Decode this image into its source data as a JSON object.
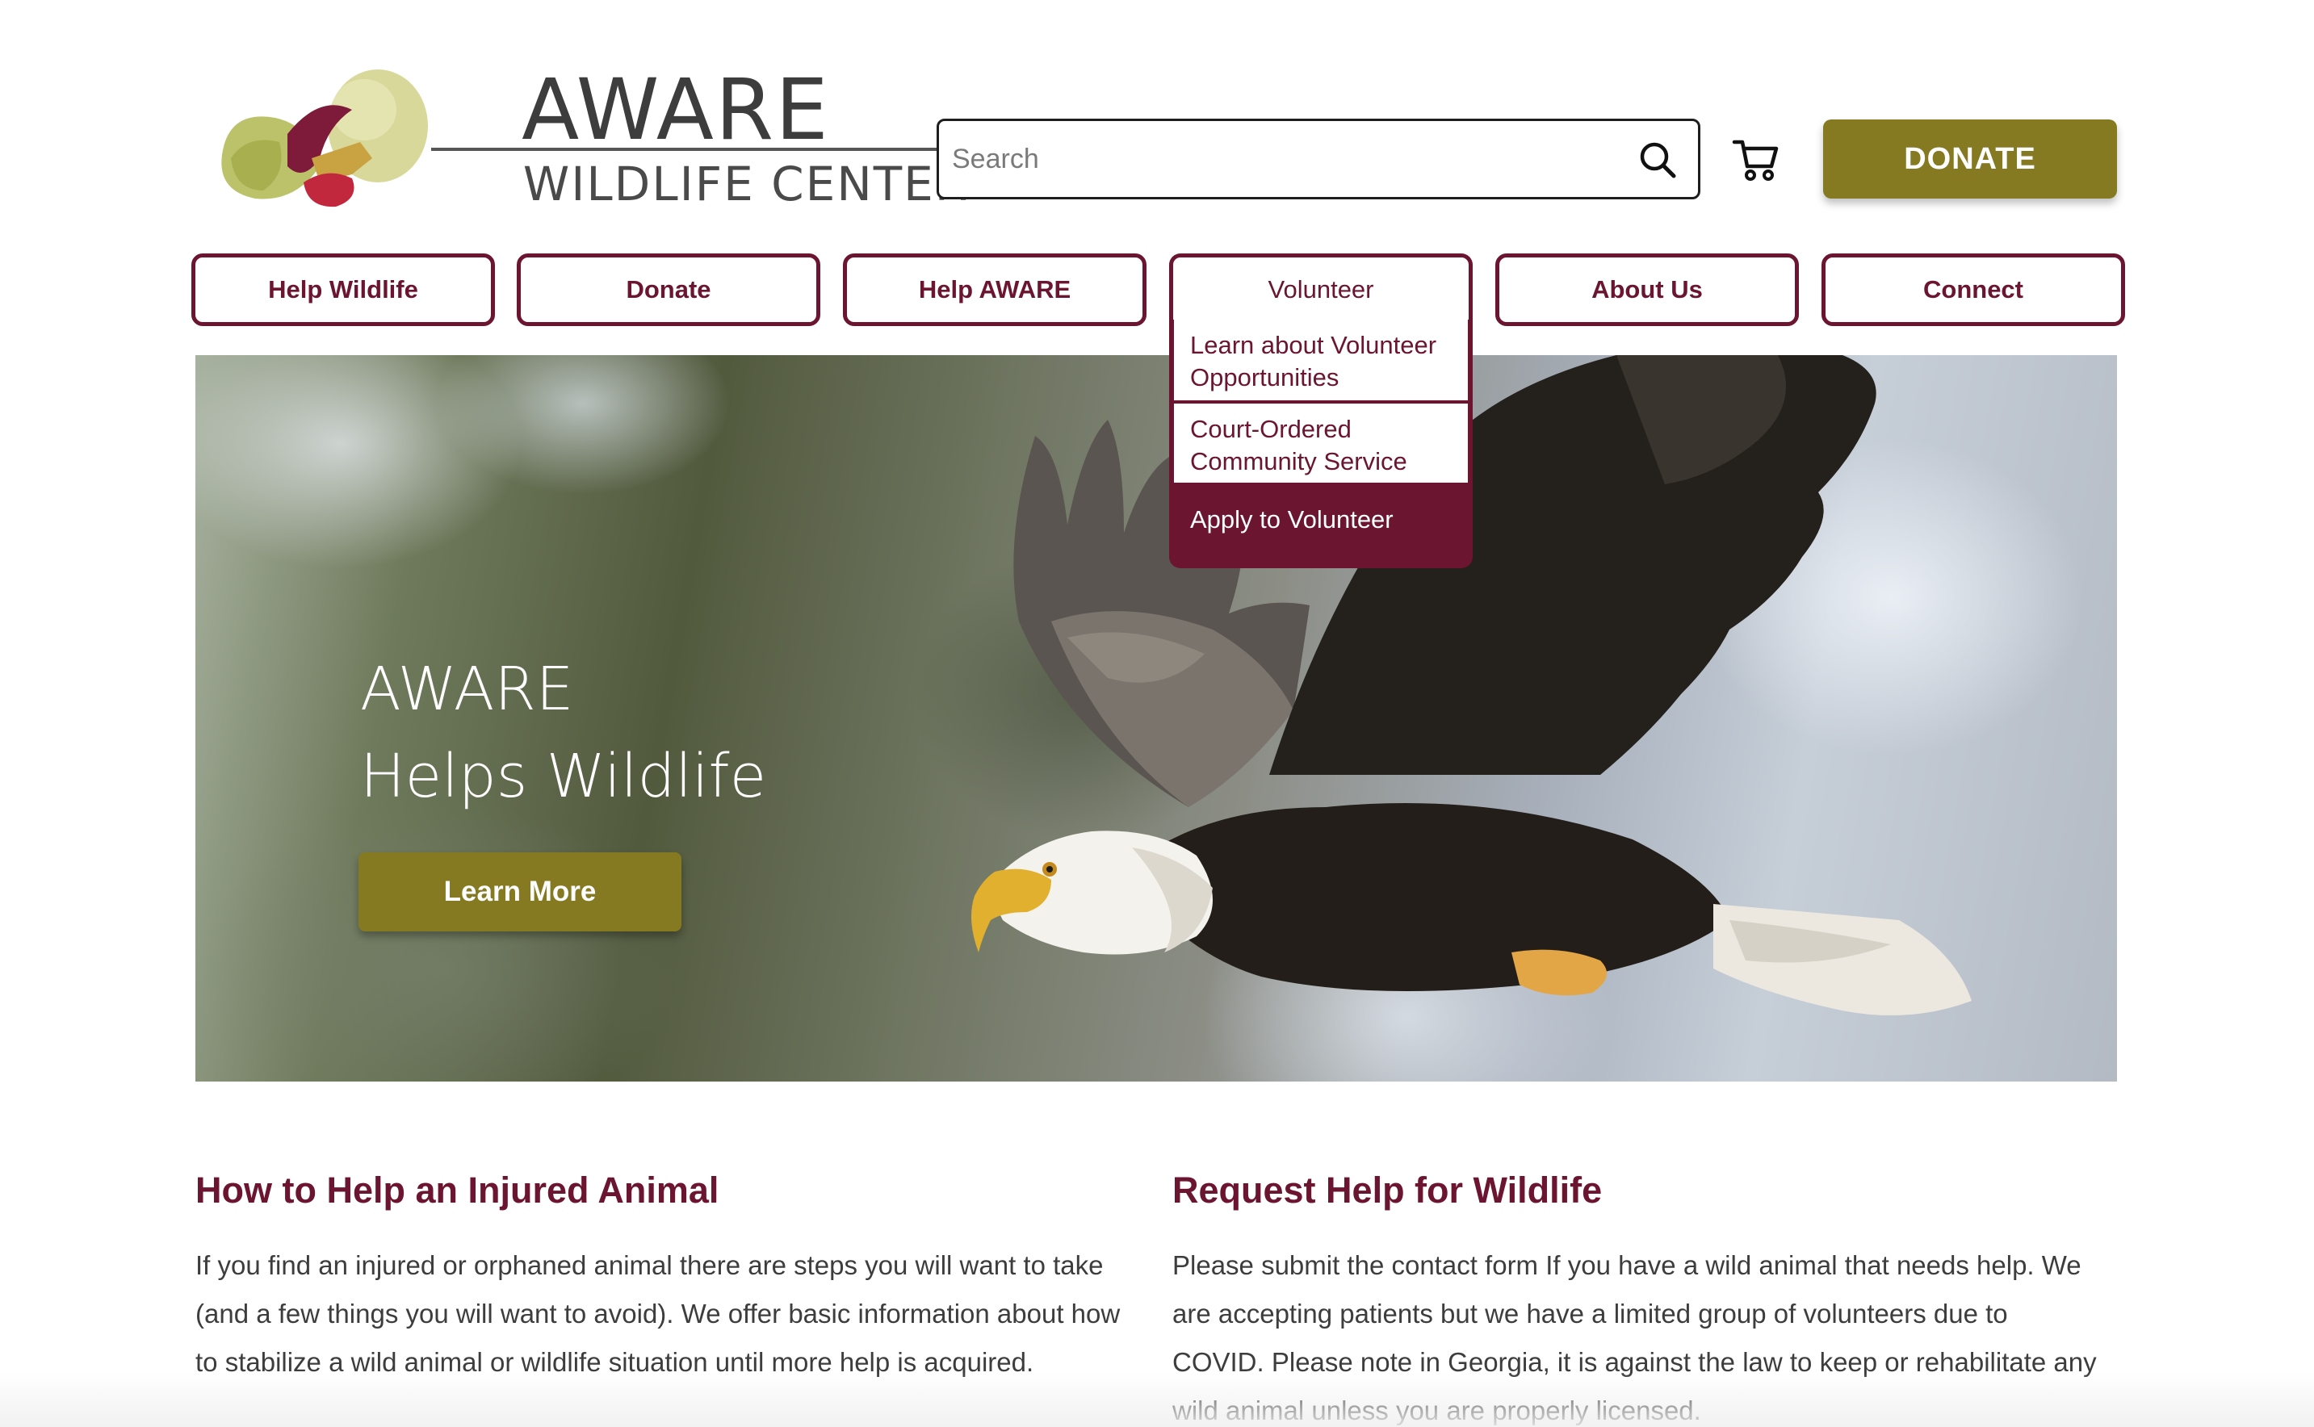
{
  "logo": {
    "line1": "AWARE",
    "line2": "WILDLIFE CENTER"
  },
  "search": {
    "placeholder": "Search"
  },
  "header": {
    "donate_label": "DONATE"
  },
  "nav": {
    "items": [
      {
        "label": "Help Wildlife"
      },
      {
        "label": "Donate"
      },
      {
        "label": "Help AWARE"
      },
      {
        "label": "Volunteer"
      },
      {
        "label": "About Us"
      },
      {
        "label": "Connect"
      }
    ],
    "volunteer_menu": [
      {
        "label": "Learn about Volunteer Opportunities"
      },
      {
        "label": "Court-Ordered Community Service"
      },
      {
        "label": "Apply to Volunteer"
      }
    ]
  },
  "hero": {
    "title_line1": "AWARE",
    "title_line2": "Helps Wildlife",
    "cta_label": "Learn More"
  },
  "sections": [
    {
      "heading": "How to Help an Injured Animal",
      "body": "If you find an injured or orphaned animal there are steps you will want to take (and a few things you will want to avoid). We offer basic information about how to stabilize a wild animal or wildlife situation until more help is acquired."
    },
    {
      "heading": "Request Help for Wildlife",
      "body": "Please submit the contact form If you have a wild animal that needs help. We are accepting patients but we have a limited group of volunteers due to COVID. Please note in Georgia, it is against the law to keep or rehabilitate any wild animal unless you are properly licensed."
    }
  ],
  "colors": {
    "brand_maroon": "#6b1530",
    "brand_olive": "#857a22"
  }
}
